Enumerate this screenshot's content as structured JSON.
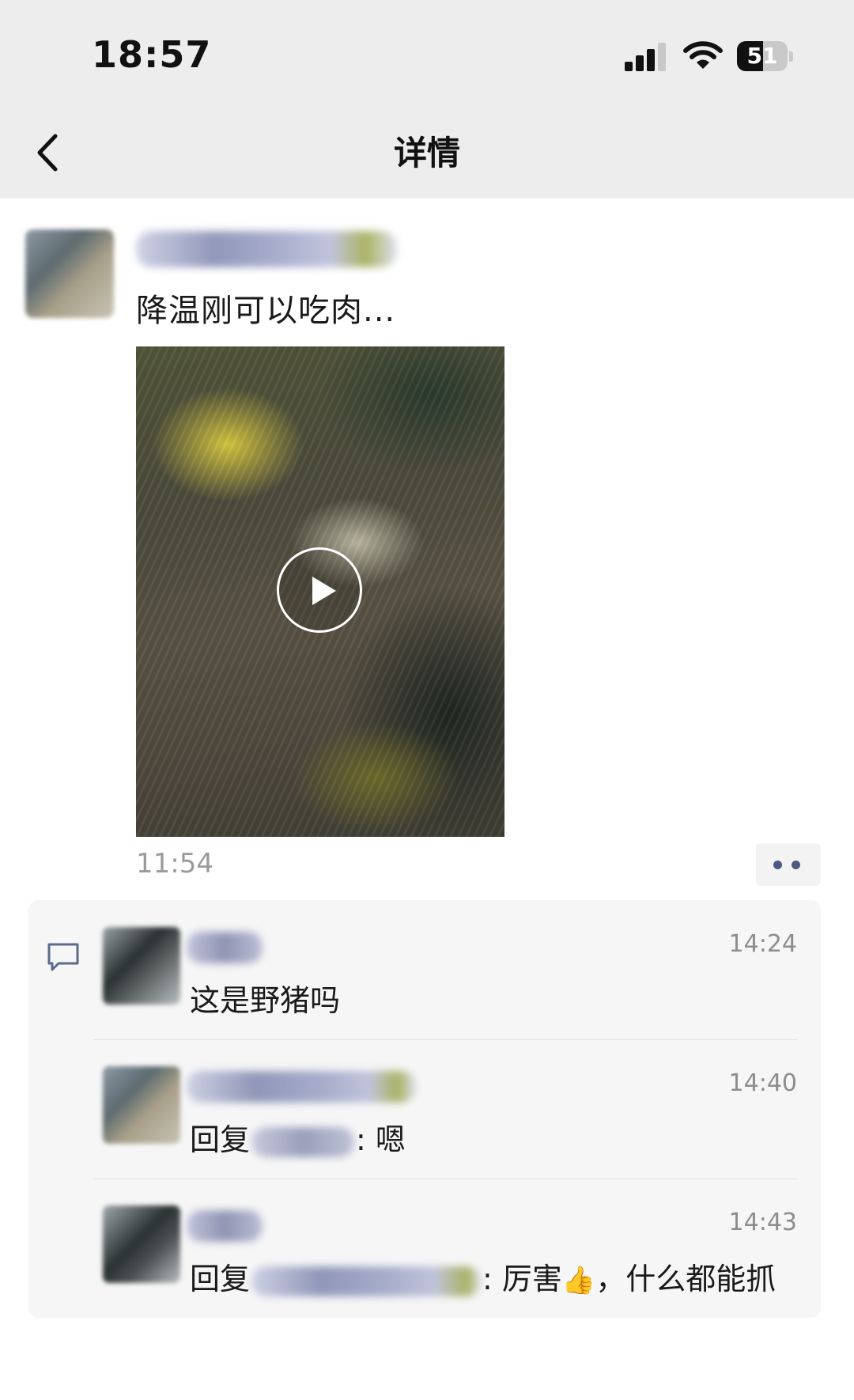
{
  "status_bar": {
    "time": "18:57",
    "battery_level": "51",
    "battery_fraction": 0.51
  },
  "nav": {
    "title": "详情",
    "back_icon": "chevron-left-icon"
  },
  "post": {
    "text": "降温刚可以吃肉...",
    "time": "11:54",
    "video_icon": "play-icon",
    "more_icon": "more-dots-icon"
  },
  "comments": [
    {
      "time": "14:24",
      "text": "这是野猪吗"
    },
    {
      "time": "14:40",
      "reply_prefix": "回复",
      "reply_text": ": 嗯"
    },
    {
      "time": "14:43",
      "reply_prefix": "回复",
      "reply_text": ": 厉害",
      "reply_suffix": "，什么都能抓"
    }
  ],
  "colors": {
    "header_bg": "#ededed",
    "comment_bg": "#f6f6f6",
    "link_dots": "#4d5a80",
    "muted_text": "#9b9b9b"
  }
}
